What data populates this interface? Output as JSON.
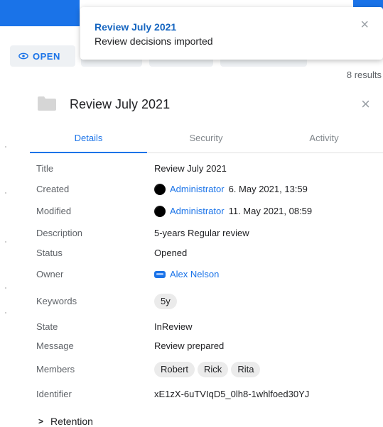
{
  "toast": {
    "title": "Review July 2021",
    "message": "Review decisions imported",
    "close_icon": "×"
  },
  "toolbar": {
    "open_label": "OPEN"
  },
  "results": "8 results",
  "panel": {
    "title": "Review July 2021",
    "close_icon": "×"
  },
  "tabs": [
    {
      "label": "Details",
      "active": true
    },
    {
      "label": "Security",
      "active": false
    },
    {
      "label": "Activity",
      "active": false
    }
  ],
  "details": {
    "title": {
      "label": "Title",
      "value": "Review July 2021"
    },
    "created": {
      "label": "Created",
      "user": "Administrator",
      "date": "6. May 2021, 13:59"
    },
    "modified": {
      "label": "Modified",
      "user": "Administrator",
      "date": "11. May 2021, 08:59"
    },
    "description": {
      "label": "Description",
      "value": "5-years Regular review"
    },
    "status": {
      "label": "Status",
      "value": "Opened"
    },
    "owner": {
      "label": "Owner",
      "value": "Alex Nelson"
    },
    "keywords": {
      "label": "Keywords",
      "values": [
        "5y"
      ]
    },
    "state": {
      "label": "State",
      "value": "InReview"
    },
    "message": {
      "label": "Message",
      "value": "Review prepared"
    },
    "members": {
      "label": "Members",
      "values": [
        "Robert",
        "Rick",
        "Rita"
      ]
    },
    "identifier": {
      "label": "Identifier",
      "value": "xE1zX-6uTVIqD5_0lh8-1whlfoed30YJ"
    }
  },
  "retention": {
    "label": "Retention",
    "icon": ">"
  },
  "colors": {
    "accent": "#1a73e8",
    "toast_title": "#1565c0"
  }
}
